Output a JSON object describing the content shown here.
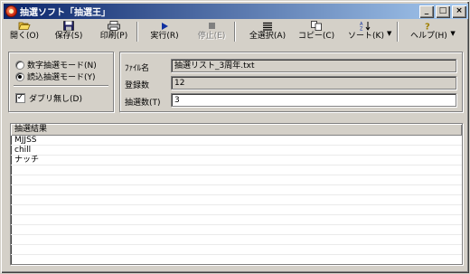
{
  "window": {
    "title": "抽選ソフト「抽選王」",
    "controls": {
      "minimize": "_",
      "maximize": "□",
      "close": "×"
    }
  },
  "toolbar": {
    "open": {
      "label": "開く(O)",
      "icon": "folder-open-icon"
    },
    "save": {
      "label": "保存(S)",
      "icon": "floppy-disk-icon"
    },
    "print": {
      "label": "印刷(P)",
      "icon": "printer-icon"
    },
    "run": {
      "label": "実行(R)",
      "icon": "play-icon"
    },
    "stop": {
      "label": "停止(E)",
      "icon": "stop-icon",
      "disabled": true
    },
    "select_all": {
      "label": "全選択(A)",
      "icon": "select-all-icon"
    },
    "copy": {
      "label": "コピー(C)",
      "icon": "copy-icon"
    },
    "sort": {
      "label": "ソート(K)",
      "icon": "sort-icon"
    },
    "help": {
      "label": "ヘルプ(H)",
      "icon": "help-icon"
    },
    "dropdown_glyph": "▼"
  },
  "mode": {
    "numeric_label": "数字抽選モード(N)",
    "numeric_selected": false,
    "read_label": "読込抽選モード(Y)",
    "read_selected": true,
    "no_duplicate_label": "ダブリ無し(D)",
    "no_duplicate_checked": true
  },
  "file_info": {
    "filename_label": "ﾌｧｲﾙ名",
    "filename_value": "抽選リスト_3周年.txt",
    "count_label": "登録数",
    "count_value": "12",
    "draw_count_label": "抽選数(T)",
    "draw_count_value": "3"
  },
  "results": {
    "header": "抽選結果",
    "items": [
      "MJJSS",
      "chill",
      "ナッチ"
    ]
  },
  "colors": {
    "title_gradient_start": "#0a246a",
    "title_gradient_end": "#a6caf0",
    "face": "#d4d0c8"
  }
}
